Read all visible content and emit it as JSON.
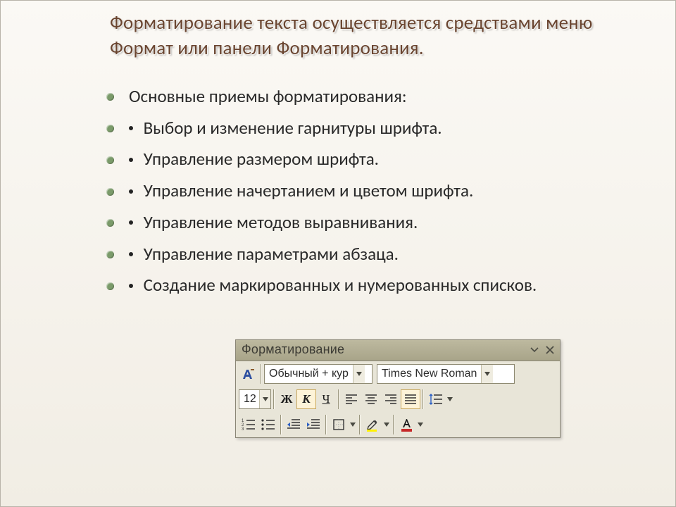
{
  "title": "Форматирование текста осуществляется средствами меню Формат или панели Форматирования.",
  "bullets": [
    "Основные приемы форматирования:",
    "Выбор и изменение гарнитуры шрифта.",
    "Управление размером шрифта.",
    "Управление начертанием и цветом шрифта.",
    "Управление методов выравнивания.",
    "Управление параметрами абзаца.",
    "Создание маркированных и нумерованных списков."
  ],
  "toolbar": {
    "title": "Форматирование",
    "style": "Обычный + кур",
    "font": "Times New Roman",
    "size": "12",
    "bold": "Ж",
    "italic": "К",
    "underline": "Ч"
  }
}
